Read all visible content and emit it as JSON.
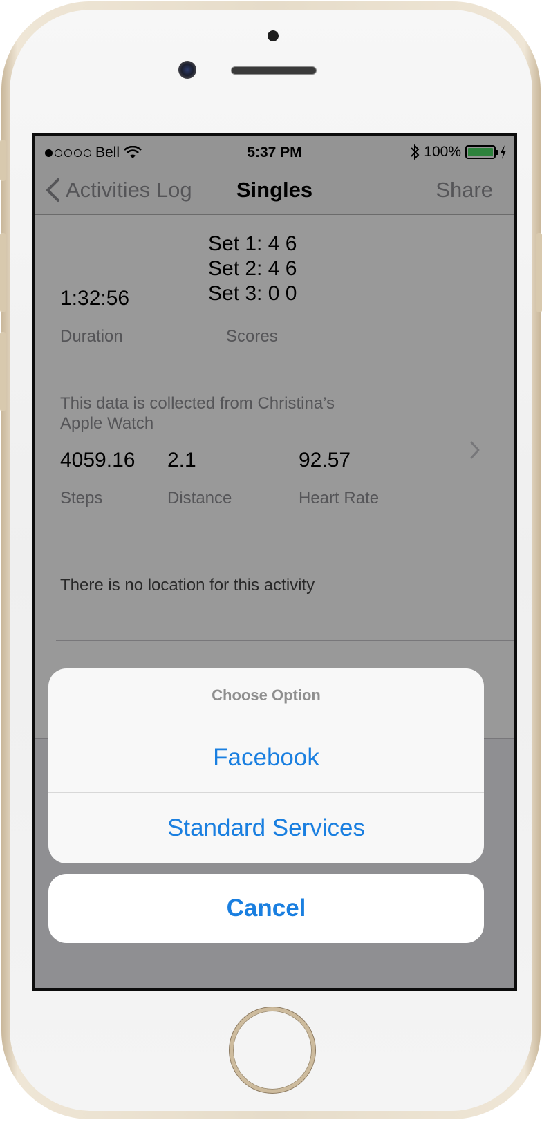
{
  "status_bar": {
    "carrier": "Bell",
    "time": "5:37 PM",
    "battery_percent": "100%",
    "signal_dots_filled": 1,
    "signal_dots_total": 5
  },
  "nav": {
    "back_label": "Activities Log",
    "title": "Singles",
    "share_label": "Share"
  },
  "summary": {
    "duration_value": "1:32:56",
    "duration_label": "Duration",
    "scores": [
      "Set 1: 4 6",
      "Set 2: 4 6",
      "Set 3: 0 0"
    ],
    "scores_label": "Scores"
  },
  "watch": {
    "source_text": "This data is collected from Christina’s Apple Watch",
    "steps_value": "4059.16",
    "steps_label": "Steps",
    "distance_value": "2.1",
    "distance_label": "Distance",
    "heart_rate_value": "92.57",
    "heart_rate_label": "Heart Rate"
  },
  "location": {
    "text": "There is no location for this activity"
  },
  "action_sheet": {
    "title": "Choose Option",
    "options": [
      "Facebook",
      "Standard Services"
    ],
    "cancel_label": "Cancel"
  },
  "colors": {
    "action_blue": "#1a7fe0",
    "battery_green": "#4cd964",
    "secondary_gray": "#8e8e93"
  },
  "icons": {
    "wifi": "wifi-icon",
    "bluetooth": "bluetooth-icon",
    "charging": "charging-bolt-icon",
    "back": "chevron-left-icon",
    "disclosure": "chevron-right-icon"
  }
}
